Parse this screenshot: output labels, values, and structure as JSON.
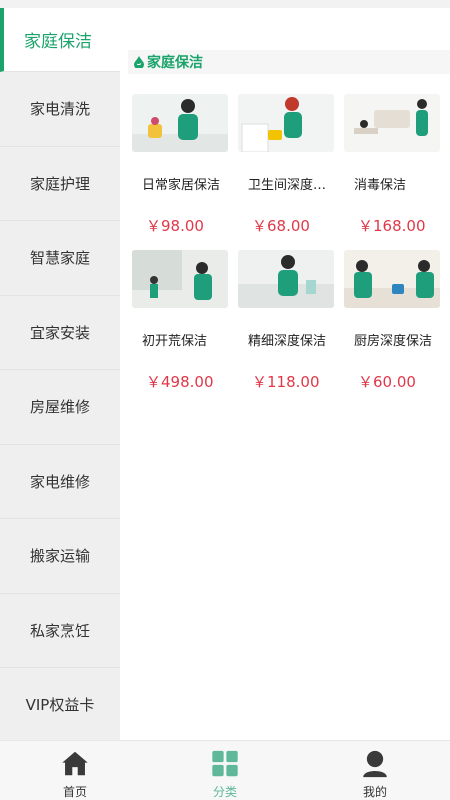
{
  "sidebar": {
    "items": [
      {
        "label": "家庭保洁"
      },
      {
        "label": "家电清洗"
      },
      {
        "label": "家庭护理"
      },
      {
        "label": "智慧家庭"
      },
      {
        "label": "宜家安装"
      },
      {
        "label": "房屋维修"
      },
      {
        "label": "家电维修"
      },
      {
        "label": "搬家运输"
      },
      {
        "label": "私家烹饪"
      },
      {
        "label": "VIP权益卡"
      }
    ]
  },
  "section": {
    "title": "家庭保洁"
  },
  "products": [
    {
      "name": "日常家居保洁",
      "price": "￥98.00"
    },
    {
      "name": "卫生间深度保洁",
      "price": "￥68.00"
    },
    {
      "name": "消毒保洁",
      "price": "￥168.00"
    },
    {
      "name": "初开荒保洁",
      "price": "￥498.00"
    },
    {
      "name": "精细深度保洁",
      "price": "￥118.00"
    },
    {
      "name": "厨房深度保洁",
      "price": "￥60.00"
    }
  ],
  "tabbar": {
    "home": "首页",
    "category": "分类",
    "mine": "我的"
  },
  "colors": {
    "accent": "#1aa36a",
    "price": "#e03848",
    "tab_active": "#5fb89a"
  }
}
